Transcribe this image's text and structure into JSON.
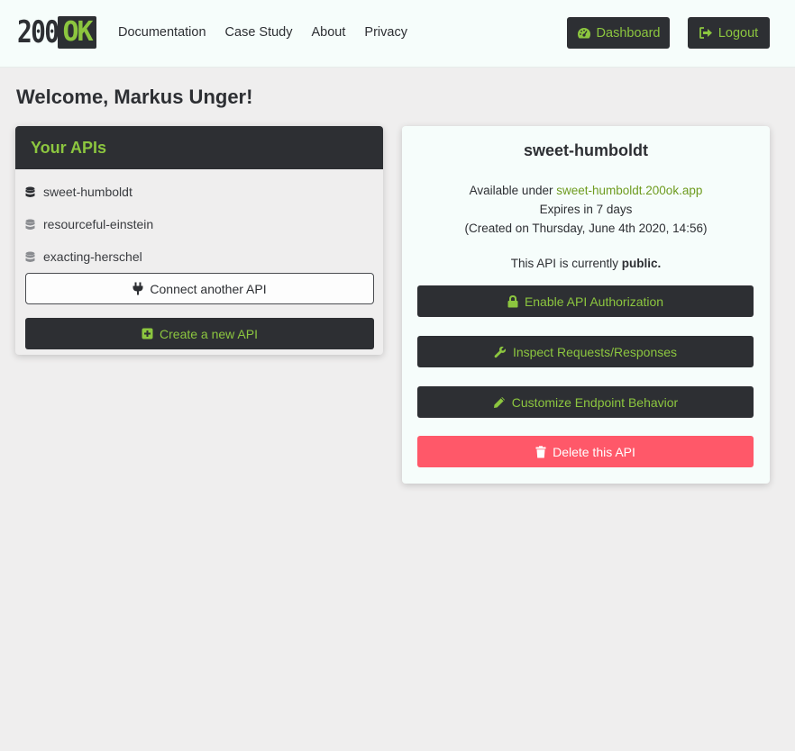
{
  "brand": {
    "number": "200",
    "ok": "OK"
  },
  "nav": {
    "links": [
      "Documentation",
      "Case Study",
      "About",
      "Privacy"
    ],
    "dashboard_label": "Dashboard",
    "logout_label": "Logout"
  },
  "welcome": "Welcome, Markus Unger!",
  "apis_panel": {
    "title": "Your APIs",
    "items": [
      "sweet-humboldt",
      "resourceful-einstein",
      "exacting-herschel"
    ],
    "connect_label": "Connect another API",
    "create_label": "Create a new API"
  },
  "detail": {
    "name": "sweet-humboldt",
    "available_prefix": "Available under",
    "url": "sweet-humboldt.200ok.app",
    "expires": "Expires in 7 days",
    "created": "(Created on Thursday, June 4th 2020, 14:56)",
    "public_prefix": "This API is currently",
    "public_state": "public.",
    "auth_label": "Enable API Authorization",
    "inspect_label": "Inspect Requests/Responses",
    "customize_label": "Customize Endpoint Behavior",
    "delete_label": "Delete this API"
  },
  "colors": {
    "dark": "#2d2f33",
    "accent": "#8cc63f",
    "danger": "#ff5869",
    "background": "#efeeee",
    "card": "#f6fdfb"
  },
  "icons": [
    "dashboard-icon",
    "logout-icon",
    "database-icon",
    "plug-icon",
    "plus-square-icon",
    "lock-icon",
    "wrench-icon",
    "pencil-icon",
    "trash-icon"
  ]
}
